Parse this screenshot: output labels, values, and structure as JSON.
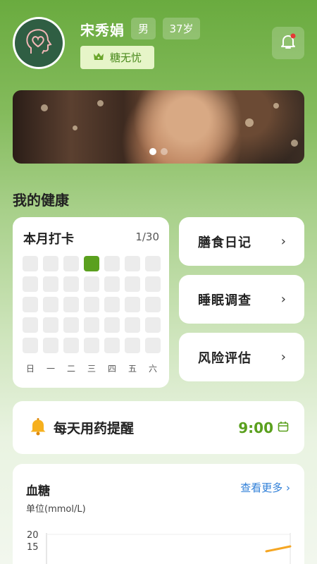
{
  "profile": {
    "name": "宋秀娟",
    "gender": "男",
    "age": "37岁",
    "badge": "糖无忧",
    "avatar_icon": "head-heart-logo",
    "badge_icon": "crown-icon",
    "notification_icon": "bell-icon"
  },
  "banner": {
    "slides": 2,
    "active_slide": 1
  },
  "health": {
    "section_title": "我的健康",
    "checkin": {
      "title": "本月打卡",
      "count": "1/30",
      "checked_cells": [
        3
      ],
      "weekdays": [
        "日",
        "一",
        "二",
        "三",
        "四",
        "五",
        "六"
      ]
    },
    "entries": [
      {
        "label": "膳食日记",
        "icon": "chevron-right-icon"
      },
      {
        "label": "睡眠调查",
        "icon": "chevron-right-icon"
      },
      {
        "label": "风险评估",
        "icon": "chevron-right-icon"
      }
    ]
  },
  "reminder": {
    "icon": "bell-icon",
    "label": "每天用药提醒",
    "time": "9:00",
    "edit_icon": "calendar-icon"
  },
  "glucose": {
    "title": "血糖",
    "more": "查看更多",
    "unit": "单位(mmol/L)",
    "chart_data": {
      "type": "line",
      "ytick_labels": [
        "20",
        "15"
      ],
      "accent": "#f5a623"
    }
  },
  "colors": {
    "accent": "#5aa01e",
    "link": "#2f7fd8"
  }
}
